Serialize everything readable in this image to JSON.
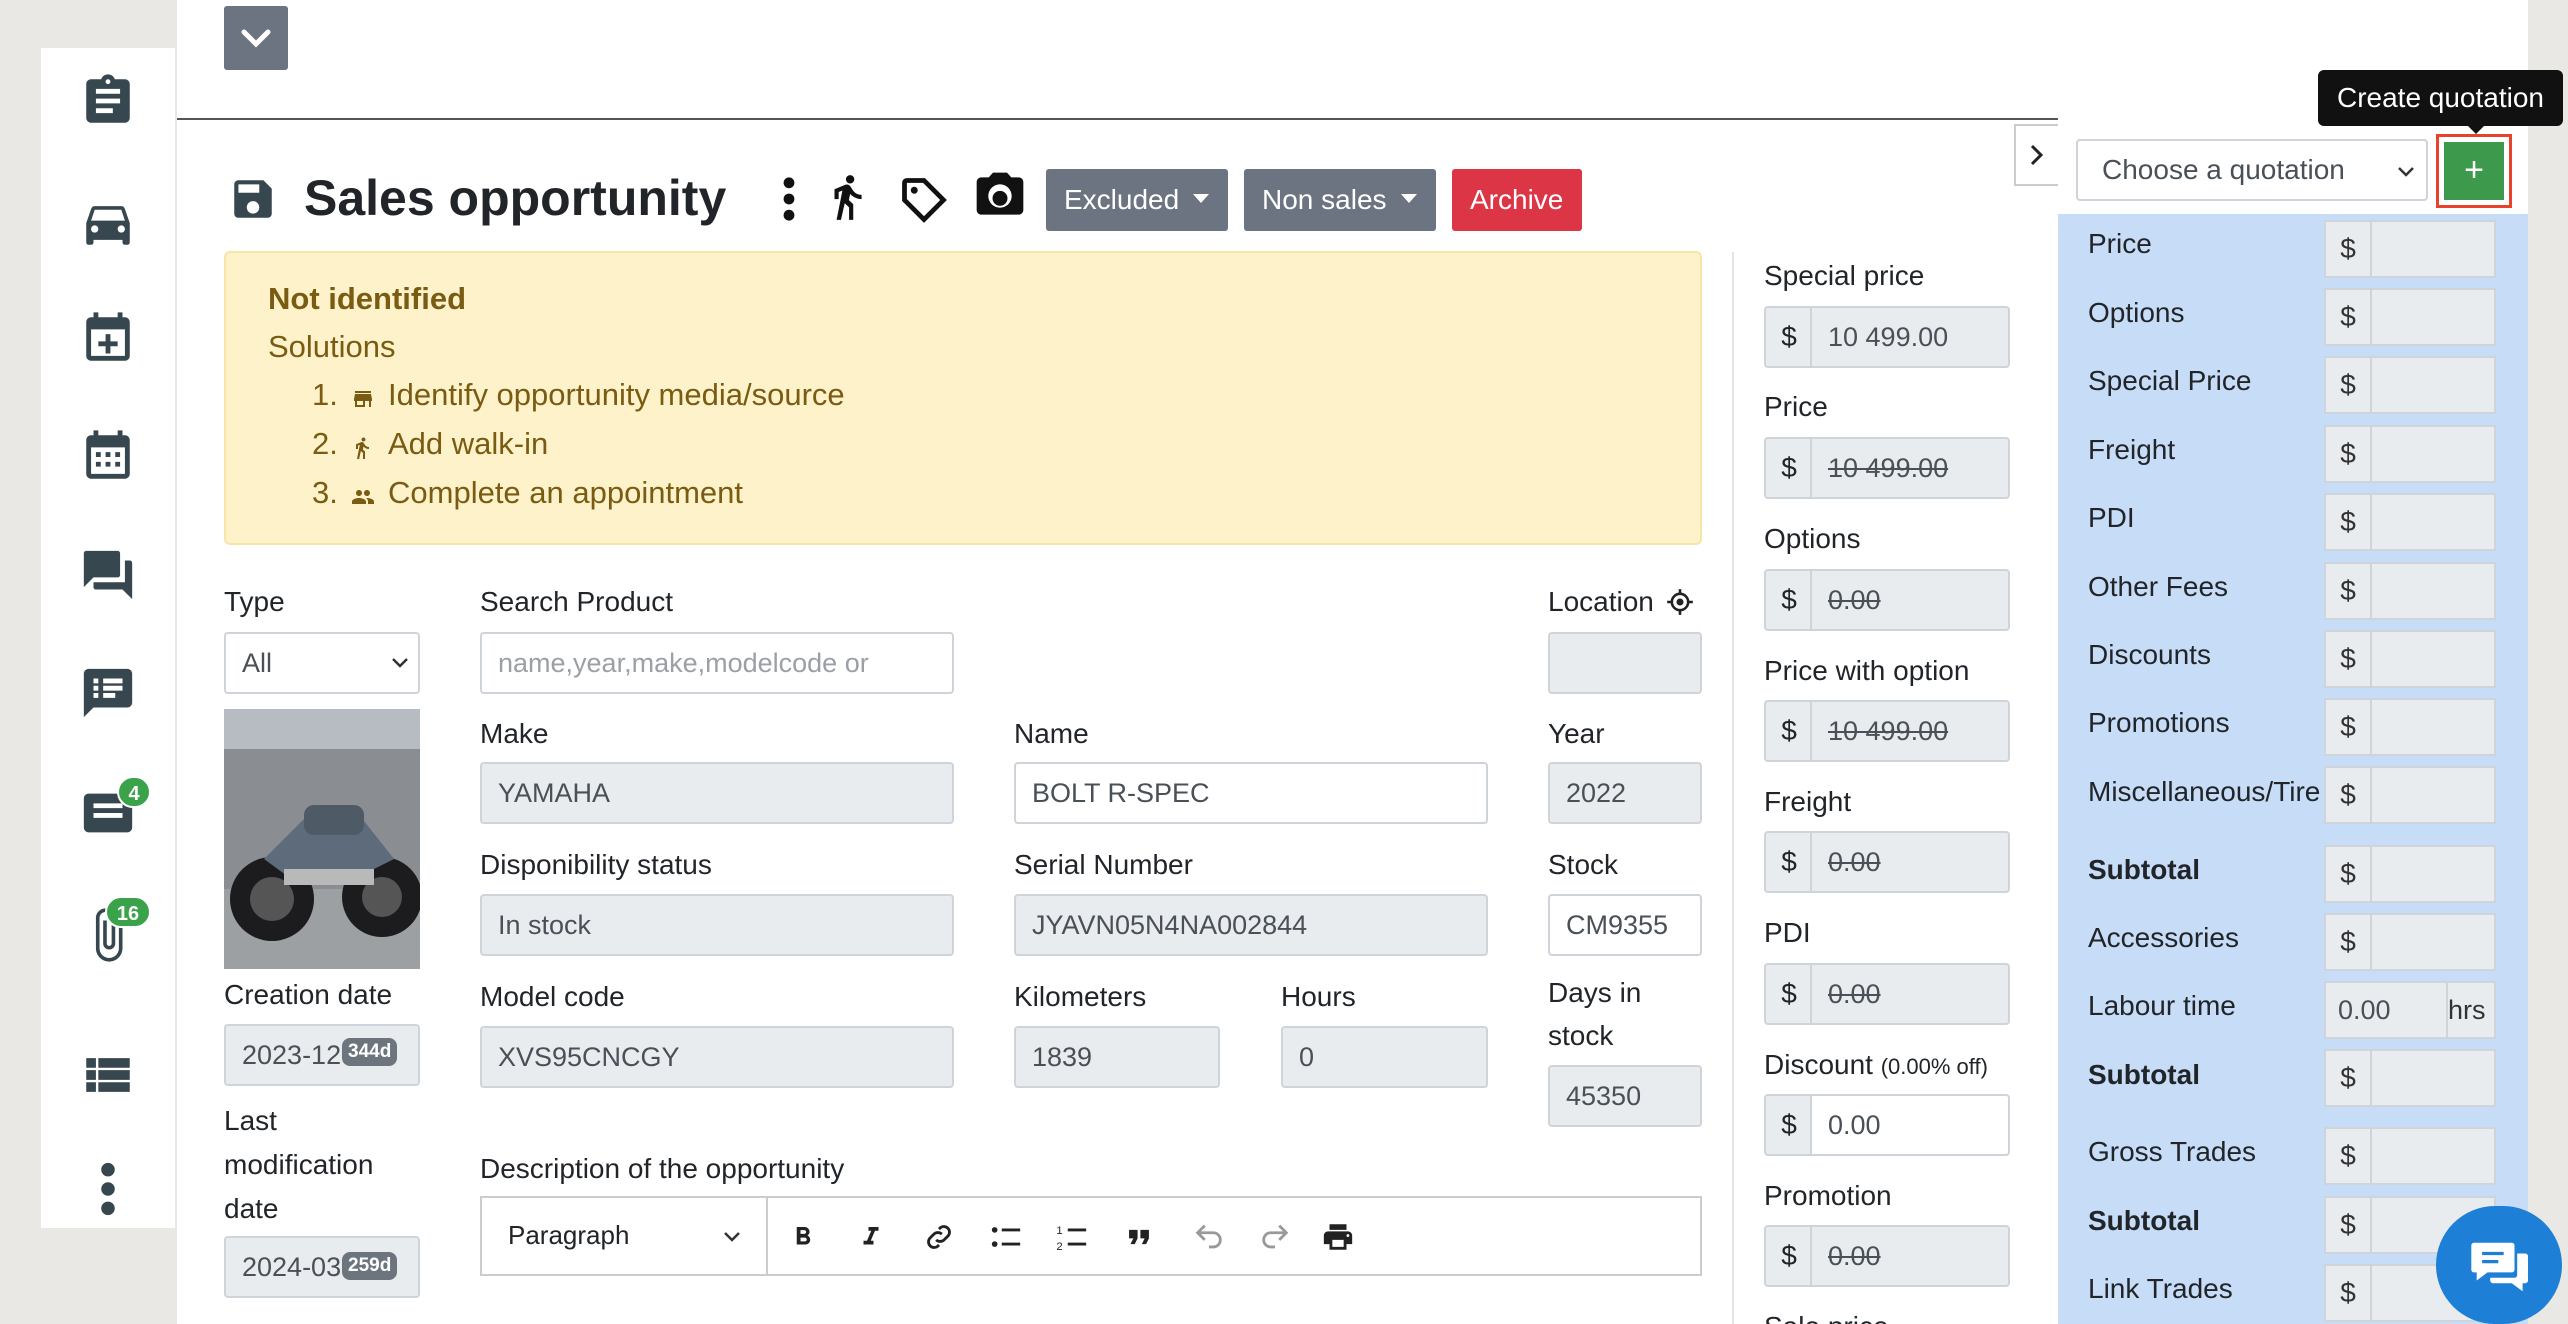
{
  "sidebar": {
    "badges": {
      "messages_count": "4",
      "attachments_count": "16"
    }
  },
  "header": {
    "title": "Sales opportunity",
    "buttons": {
      "excluded": "Excluded",
      "non_sales": "Non sales",
      "archive": "Archive"
    }
  },
  "alert": {
    "title": "Not identified",
    "subtitle": "Solutions",
    "items": [
      "1.",
      "Identify opportunity media/source",
      "2.",
      "Add walk-in",
      "3.",
      "Complete an appointment"
    ]
  },
  "form": {
    "type_label": "Type",
    "type_value": "All",
    "search_label": "Search Product",
    "search_placeholder": "name,year,make,modelcode or",
    "location_label": "Location",
    "location_value": "",
    "make_label": "Make",
    "make_value": "YAMAHA",
    "name_label": "Name",
    "name_value": "BOLT R-SPEC",
    "year_label": "Year",
    "year_value": "2022",
    "dispo_label": "Disponibility status",
    "dispo_value": "In stock",
    "serial_label": "Serial Number",
    "serial_value": "JYAVN05N4NA002844",
    "stock_label": "Stock",
    "stock_value": "CM9355",
    "creation_label": "Creation date",
    "creation_value": "2023-12",
    "creation_badge": "344d",
    "model_label": "Model code",
    "model_value": "XVS95CNCGY",
    "km_label": "Kilometers",
    "km_value": "1839",
    "hours_label": "Hours",
    "hours_value": "0",
    "days_label_1": "Days in",
    "days_label_2": "stock",
    "days_value": "45350",
    "lastmod_label_1": "Last",
    "lastmod_label_2": "modification",
    "lastmod_label_3": "date",
    "lastmod_value": "2024-03",
    "lastmod_badge": "259d",
    "desc_label": "Description of the opportunity",
    "editor_paragraph": "Paragraph"
  },
  "pricing": {
    "special_price_label": "Special price",
    "special_price_value": "10 499.00",
    "price_label": "Price",
    "price_value": "10 499.00",
    "options_label": "Options",
    "options_value": "0.00",
    "pwo_label": "Price with option",
    "pwo_value": "10 499.00",
    "freight_label": "Freight",
    "freight_value": "0.00",
    "pdi_label": "PDI",
    "pdi_value": "0.00",
    "discount_label": "Discount",
    "discount_note": "(0.00% off)",
    "discount_value": "0.00",
    "promotion_label": "Promotion",
    "promotion_value": "0.00",
    "currency": "$",
    "cut_label": "Sale price"
  },
  "quotation": {
    "tooltip": "Create quotation",
    "select_placeholder": "Choose a quotation",
    "add_label": "+",
    "rows": [
      "Price",
      "Options",
      "Special Price",
      "Freight",
      "PDI",
      "Other Fees",
      "Discounts",
      "Promotions",
      "Miscellaneous/Tire",
      "Subtotal",
      "Accessories",
      "Labour time",
      "Subtotal",
      "Gross Trades",
      "Subtotal",
      "Link Trades"
    ],
    "labour_value": "0.00",
    "labour_unit": "hrs",
    "currency": "$"
  }
}
